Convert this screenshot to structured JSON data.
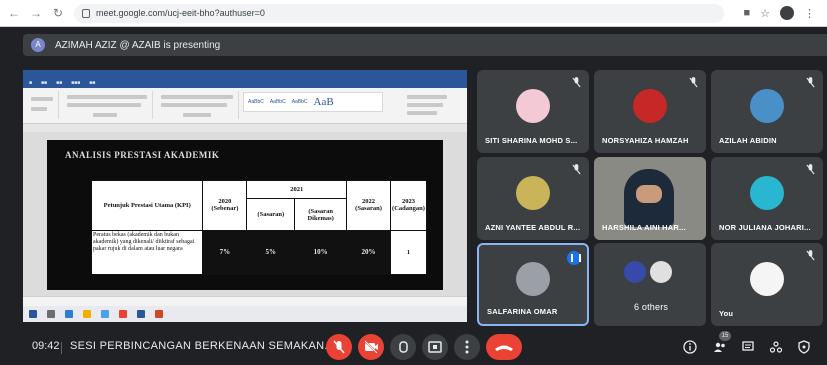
{
  "browser": {
    "url": "meet.google.com/ucj-eeit-bho?authuser=0"
  },
  "presenting": {
    "avatar_letter": "A",
    "text": "AZIMAH AZIZ @ AZAIB is presenting"
  },
  "shared_screen": {
    "doc_heading": "ANALISIS PRESTASI AKADEMIK",
    "table": {
      "header_main": "Petunjuk Prestasi Utama (KPI)",
      "header_2020": "2020",
      "header_2020_sub": "(Sebenar)",
      "header_2021": "2021",
      "header_2021_sub1": "(Sasaran)",
      "header_2021_sub2": "(Sasaran Dikemas)",
      "header_2022": "2022",
      "header_2022_sub": "(Sasaran)",
      "header_2023": "2023",
      "header_2023_sub": "(Cadangan)",
      "row_text": "Peratus bekas (akademik dan bukan akademik) yang dikenali/ diiktiraf sebagai pakar rujuk di dalam atau luar negara",
      "row_values": [
        "7%",
        "5%",
        "10%",
        "20%",
        "1"
      ]
    }
  },
  "participants": [
    {
      "name": "SITI SHARINA MOHD S...",
      "muted": true
    },
    {
      "name": "NORSYAHIZA HAMZAH",
      "muted": true
    },
    {
      "name": "AZILAH ABIDIN",
      "muted": true
    },
    {
      "name": "AZNI YANTEE ABDUL R...",
      "muted": true
    },
    {
      "name": "HARSHILA AINI HAR...",
      "muted": false
    },
    {
      "name": "NOR JULIANA JOHARI...",
      "muted": true
    },
    {
      "name": "SALFARINA OMAR",
      "speaking": true
    },
    {
      "name": "6 others"
    },
    {
      "name": "You",
      "muted": true
    }
  ],
  "bottom_bar": {
    "time": "09:42",
    "meeting_title": "SESI PERBINCANGAN BERKENAAN SEMAKAN...",
    "people_count": "15"
  },
  "colors": {
    "background": "#202124",
    "tile": "#3c4043",
    "danger": "#ea4335",
    "accent": "#1a73e8"
  }
}
